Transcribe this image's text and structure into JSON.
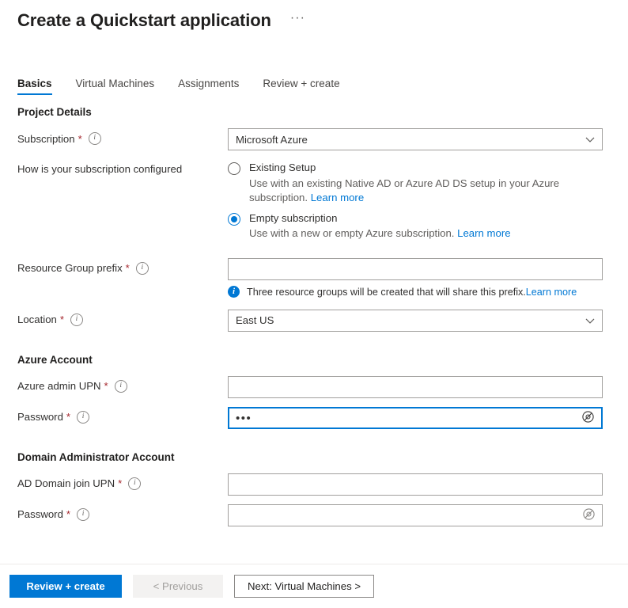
{
  "header": {
    "title": "Create a Quickstart application",
    "more_menu": "···"
  },
  "tabs": [
    {
      "label": "Basics",
      "active": true
    },
    {
      "label": "Virtual Machines",
      "active": false
    },
    {
      "label": "Assignments",
      "active": false
    },
    {
      "label": "Review + create",
      "active": false
    }
  ],
  "sections": {
    "project_details": {
      "title": "Project Details",
      "subscription": {
        "label": "Subscription",
        "required": "*",
        "value": "Microsoft Azure"
      },
      "configured": {
        "label": "How is your subscription configured",
        "options": [
          {
            "title": "Existing Setup",
            "description": "Use with an existing Native AD or Azure AD DS setup in your Azure subscription.",
            "link": "Learn more",
            "selected": false
          },
          {
            "title": "Empty subscription",
            "description": "Use with a new or empty Azure subscription.",
            "link": "Learn more",
            "selected": true
          }
        ]
      },
      "resource_group_prefix": {
        "label": "Resource Group prefix",
        "required": "*",
        "value": "",
        "placeholder": ""
      },
      "banner": {
        "text": "Three resource groups will be created that will share this prefix.",
        "link": "Learn more"
      },
      "location": {
        "label": "Location",
        "required": "*",
        "value": "East US"
      }
    },
    "azure_account": {
      "title": "Azure Account",
      "admin_upn": {
        "label": "Azure admin UPN",
        "required": "*",
        "value": "",
        "placeholder": ""
      },
      "password": {
        "label": "Password",
        "required": "*",
        "value": "•••",
        "placeholder": ""
      }
    },
    "domain_admin_account": {
      "title": "Domain Administrator Account",
      "ad_domain_join_upn": {
        "label": "AD Domain join UPN",
        "required": "*",
        "value": "",
        "placeholder": ""
      },
      "password": {
        "label": "Password",
        "required": "*",
        "value": "",
        "placeholder": ""
      }
    }
  },
  "footer": {
    "review_create": "Review + create",
    "previous": "< Previous",
    "next": "Next: Virtual Machines >"
  },
  "colors": {
    "accent": "#0078d4",
    "required": "#a4262c",
    "text": "#323130",
    "muted": "#605e5c",
    "border": "#a19f9d"
  },
  "icons": {
    "info": "i",
    "chevron": "chevron-down-icon",
    "eye": "password-reveal-icon"
  }
}
